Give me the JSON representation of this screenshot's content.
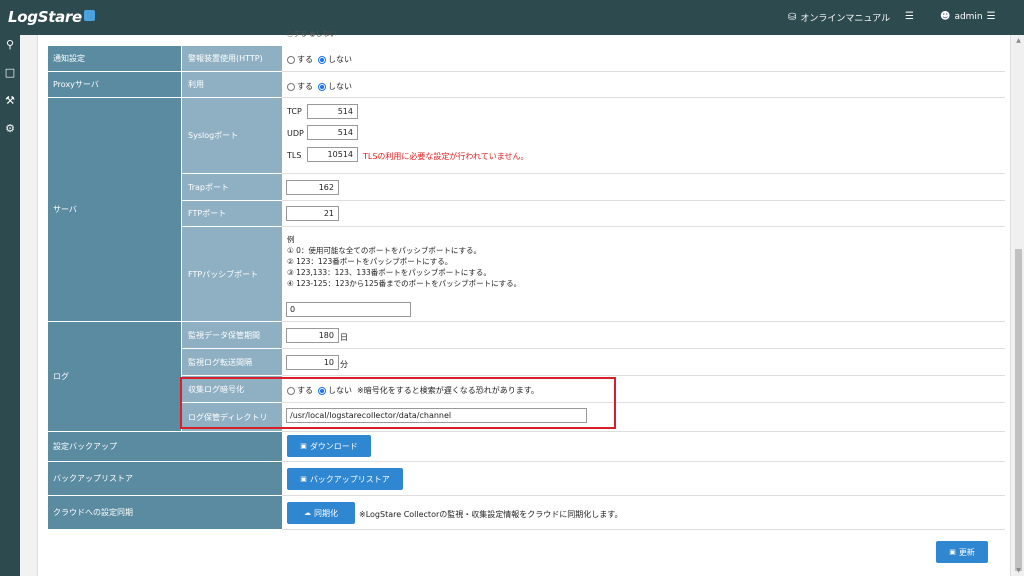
{
  "header": {
    "logo": "LogStare",
    "manual": "オンラインマニュアル",
    "user": "admin"
  },
  "rows": {
    "notify_l1": "通知設定",
    "notify_l2": "警報装置使用(HTTP)",
    "proxy_l1": "Proxyサーバ",
    "proxy_l2": "利用",
    "server_l1": "サーバ",
    "syslog_l2": "Syslogポート",
    "trap_l2": "Trapポート",
    "ftp_l2": "FTPポート",
    "passive_l2": "FTPパッシブポート",
    "log_l1": "ログ",
    "retention_l2": "監視データ保管期間",
    "transfer_l2": "監視ログ転送間隔",
    "encrypt_l2": "収集ログ暗号化",
    "dir_l2": "ログ保管ディレクトリ",
    "backup_l1": "設定バックアップ",
    "restore_l1": "バックアップリストア",
    "cloud_l1": "クラウドへの設定同期"
  },
  "radio": {
    "yes": "する",
    "no": "しない"
  },
  "ports": {
    "tcp_label": "TCP",
    "tcp": "514",
    "udp_label": "UDP",
    "udp": "514",
    "tls_label": "TLS",
    "tls": "10514",
    "tls_warning": "TLSの利用に必要な設定が行われていません。",
    "trap": "162",
    "ftp": "21"
  },
  "passive": {
    "example_title": "例",
    "ex1": "① 0：使用可能な全てのポートをパッシブポートにする。",
    "ex2": "② 123：123番ポートをパッシブポートにする。",
    "ex3": "③ 123,133：123、133番ポートをパッシブポートにする。",
    "ex4": "④ 123-125：123から125番までのポートをパッシブポートにする。",
    "value": "0"
  },
  "log": {
    "retention": "180",
    "retention_unit": "日",
    "transfer": "10",
    "transfer_unit": "分",
    "encrypt_note": "※暗号化をすると検索が遅くなる恐れがあります。",
    "dir": "/usr/local/logstarecollector/data/channel"
  },
  "buttons": {
    "download": "ダウンロード",
    "restore": "バックアップリストア",
    "sync": "同期化",
    "update": "更新"
  },
  "cloud_note": "※LogStare Collectorの監視・収集設定情報をクラウドに同期化します。",
  "top_fragment": "○する ◉しない",
  "colors": {
    "header": "#2d4a4f",
    "label1": "#5a8ba0",
    "label2": "#8fb0c3",
    "button": "#2f86d1",
    "highlight": "#d8202a",
    "warning": "#e02020"
  }
}
